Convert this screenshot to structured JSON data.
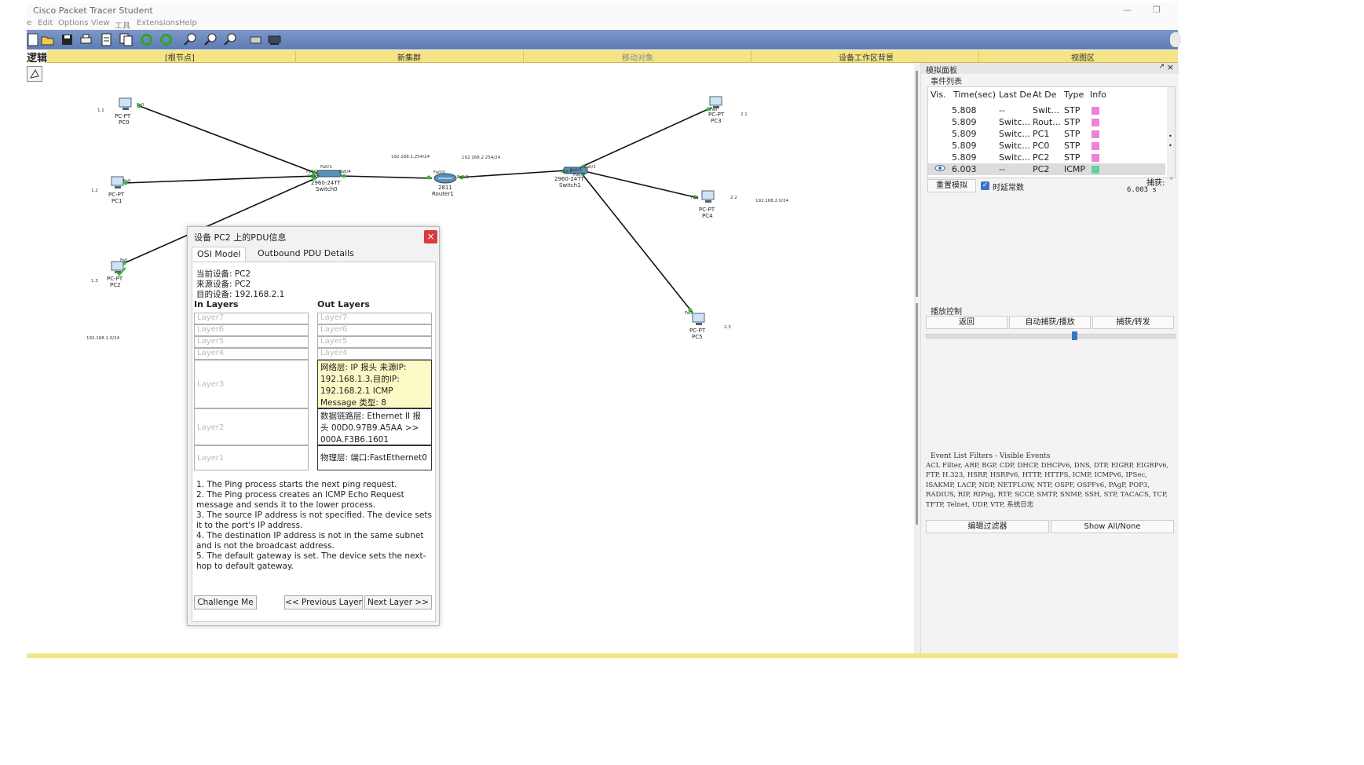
{
  "window": {
    "title": "Cisco Packet Tracer Student"
  },
  "menu": [
    "e",
    "Edit",
    "Options",
    "View",
    "工具",
    "Extensions",
    "Help"
  ],
  "workspace_bar": {
    "mode": "逻辑",
    "items": [
      "[根节点]",
      "新集群",
      "移动对象",
      "设备工作区背景",
      "视图区"
    ]
  },
  "devices": [
    {
      "name": "PC0",
      "type": "PC-PT",
      "port": "Fa0",
      "note": "1.1"
    },
    {
      "name": "PC1",
      "type": "PC-PT",
      "port": "Fa0",
      "note": "1.2"
    },
    {
      "name": "PC2",
      "type": "PC-PT",
      "port": "Fa0",
      "note": "1.3"
    },
    {
      "name": "Switch0",
      "type": "2960-24TT"
    },
    {
      "name": "Router1",
      "type": "2811"
    },
    {
      "name": "Switch1",
      "type": "2960-24TT"
    },
    {
      "name": "PC3",
      "type": "PC-PT",
      "port": "Fa0",
      "note": "2.1"
    },
    {
      "name": "PC4",
      "type": "PC-PT",
      "port": "Fa0",
      "note": "2.2"
    },
    {
      "name": "PC5",
      "type": "PC-PT",
      "port": "Fa0",
      "note": "2.3"
    }
  ],
  "network_labels": {
    "net1_gw": "192.168.1.254/24",
    "net2_gw": "192.168.2.254/24",
    "net1": "192.168.1.0/24",
    "net2": "192.168.2.0/24"
  },
  "port_labels": {
    "s0_fa01": "Fa0/1",
    "s0_fa04": "Fa0/4",
    "s0_fa02": "Fa0/2",
    "s0_fa03": "Fa0/3",
    "r_fa00": "Fa0/0",
    "r_fa01": "Fa0/1",
    "s1_fa01": "Fa0/1",
    "s1_fa04": "Fa0/4",
    "s1_fa02": "Fa0/2",
    "s1_fa03": "Fa0/3"
  },
  "pdu_dialog": {
    "title": "设备 PC2 上的PDU信息",
    "close": "×",
    "tabs": [
      "OSI Model",
      "Outbound PDU Details"
    ],
    "current_device_label": "当前设备:",
    "current_device": "PC2",
    "source_device_label": "来源设备:",
    "source_device": "PC2",
    "dest_label": "目的设备:",
    "dest": "192.168.2.1",
    "in_layers_title": "In Layers",
    "out_layers_title": "Out Layers",
    "in_layers": [
      "Layer7",
      "Layer6",
      "Layer5",
      "Layer4",
      "Layer3",
      "Layer2",
      "Layer1"
    ],
    "out_layers_empty": [
      "Layer7",
      "Layer6",
      "Layer5",
      "Layer4"
    ],
    "out_layer3": "网络层: IP 报头 来源IP: 192.168.1.3,目的IP: 192.168.2.1 ICMP Message 类型: 8",
    "out_layer2": "数据链路层: Ethernet II 报头 00D0.97B9.A5AA >> 000A.F3B6.1601",
    "out_layer1": "物理层: 端口:FastEthernet0",
    "description": [
      "1. The Ping process starts the next ping request.",
      "2. The Ping process creates an ICMP Echo Request message and sends it to the lower process.",
      "3. The source IP address is not specified. The device sets it to the port's IP address.",
      "4. The destination IP address is not in the same subnet and is not the broadcast address.",
      "5. The default gateway is set. The device sets the next-hop to default gateway."
    ],
    "buttons": {
      "challenge": "Challenge Me",
      "prev": "<< Previous Layer",
      "next": "Next Layer >>"
    }
  },
  "sim_panel": {
    "title": "模拟面板",
    "event_list_title": "事件列表",
    "columns": [
      "Vis.",
      "Time(sec)",
      "Last De",
      "At De",
      "Type",
      "Info"
    ],
    "events": [
      {
        "time": "5.808",
        "last": "--",
        "at": "Swit...",
        "type": "STP",
        "color": "#ee82d9"
      },
      {
        "time": "5.809",
        "last": "Switc...",
        "at": "Rout...",
        "type": "STP",
        "color": "#ee82d9"
      },
      {
        "time": "5.809",
        "last": "Switc...",
        "at": "PC1",
        "type": "STP",
        "color": "#ee82d9"
      },
      {
        "time": "5.809",
        "last": "Switc...",
        "at": "PC0",
        "type": "STP",
        "color": "#ee82d9"
      },
      {
        "time": "5.809",
        "last": "Switc...",
        "at": "PC2",
        "type": "STP",
        "color": "#ee82d9"
      },
      {
        "time": "6.003",
        "last": "--",
        "at": "PC2",
        "type": "ICMP",
        "color": "#66d19e",
        "selected": true
      }
    ],
    "reset_button": "重置模拟",
    "constant_delay_label": "时延常数",
    "constant_delay_checked": true,
    "capture_label": "捕获:",
    "capture_value": "6.003 s",
    "play_controls_title": "播放控制",
    "play_buttons": [
      "返回",
      "自动捕获/播放",
      "捕获/转发"
    ],
    "slider_level": 0.6,
    "filters_title": "Event List Filters - Visible Events",
    "filters_text": "ACL Filter, ARP, BGP, CDP, DHCP, DHCPv6, DNS, DTP, EIGRP, EIGRPv6, FTP, H.323, HSRP, HSRPv6, HTTP, HTTPS, ICMP, ICMPv6, IPSec, ISAKMP, LACP, NDP, NETFLOW, NTP, OSPF, OSPFv6, PAgP, POP3, RADIUS, RIP, RIPng, RTP, SCCP, SMTP, SNMP, SSH, STP, TACACS, TCP, TFTP, Telnet, UDP, VTP, 系统日志",
    "edit_filters_button": "编辑过滤器",
    "show_all_button": "Show All/None"
  },
  "colors": {
    "toolbar": "#6584bb",
    "workspace_bar": "#f4e486",
    "close_button": "#d83b3b",
    "layer_highlight": "#fbfac6"
  }
}
